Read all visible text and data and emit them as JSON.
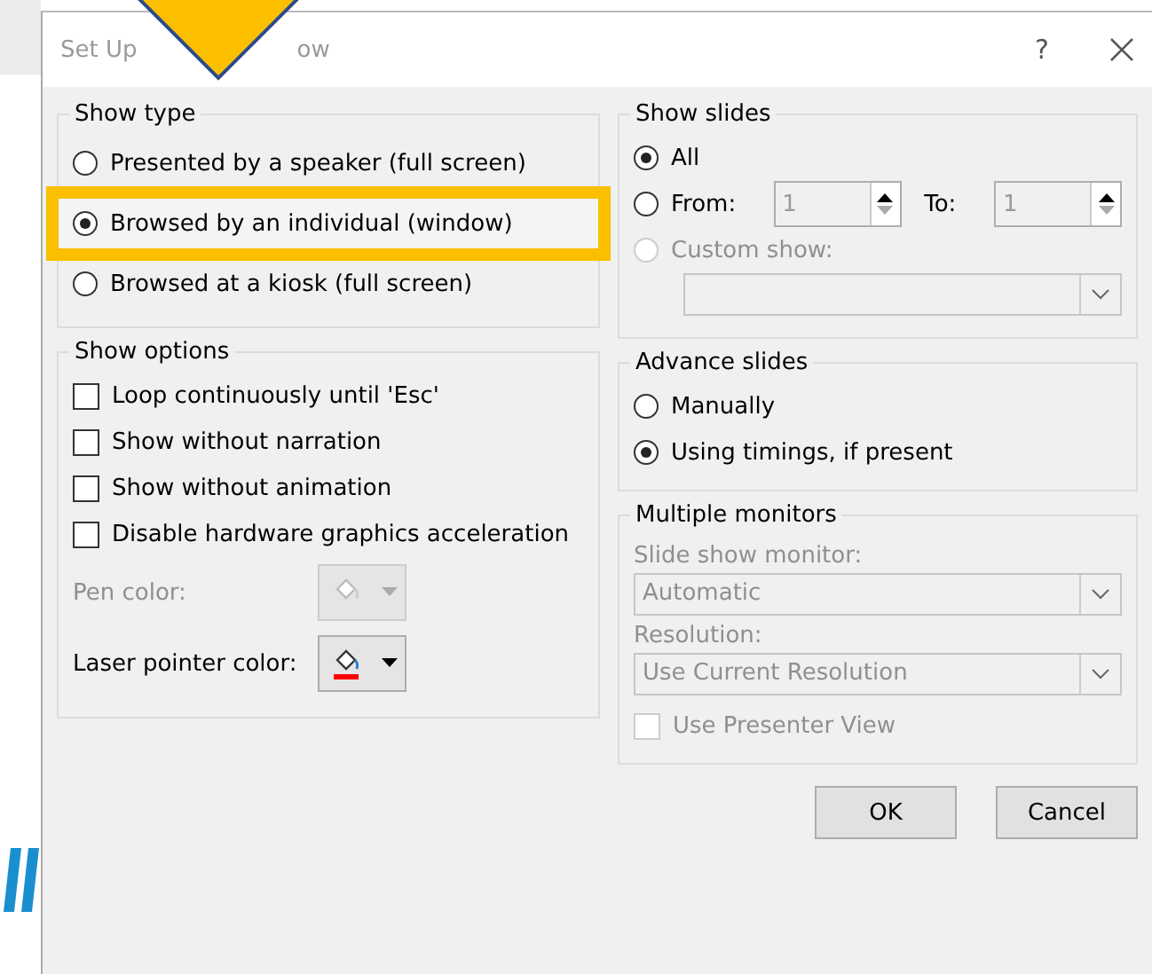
{
  "dialog": {
    "title_start": "Set Up",
    "title_end": "ow",
    "help": "?"
  },
  "show_type": {
    "label": "Show type",
    "options": [
      {
        "label": "Presented by a speaker (full screen)",
        "selected": false,
        "highlighted": false
      },
      {
        "label": "Browsed by an individual (window)",
        "selected": true,
        "highlighted": true
      },
      {
        "label": "Browsed at a kiosk (full screen)",
        "selected": false,
        "highlighted": false
      }
    ]
  },
  "show_options": {
    "label": "Show options",
    "checkboxes": [
      {
        "label": "Loop continuously until 'Esc'",
        "checked": false
      },
      {
        "label": "Show without narration",
        "checked": false
      },
      {
        "label": "Show without animation",
        "checked": false
      },
      {
        "label": "Disable hardware graphics acceleration",
        "checked": false
      }
    ],
    "colors": [
      {
        "label": "Pen color:",
        "disabled": true
      },
      {
        "label": "Laser pointer color:",
        "disabled": false,
        "color": "#ff0000"
      }
    ]
  },
  "show_slides": {
    "label": "Show slides",
    "options": [
      {
        "kind": "plain",
        "label": "All",
        "selected": true,
        "disabled": false
      },
      {
        "kind": "range",
        "label": "From:",
        "selected": false,
        "disabled": false,
        "from": "1",
        "to_label": "To:",
        "to": "1"
      },
      {
        "kind": "dropdown",
        "label": "Custom show:",
        "selected": false,
        "disabled": true
      }
    ]
  },
  "advance_slides": {
    "label": "Advance slides",
    "options": [
      {
        "label": "Manually",
        "selected": false
      },
      {
        "label": "Using timings, if present",
        "selected": true
      }
    ]
  },
  "multiple_monitors": {
    "label": "Multiple monitors",
    "disabled": true,
    "fields": [
      {
        "label": "Slide show monitor:",
        "value": "Automatic"
      },
      {
        "label": "Resolution:",
        "value": "Use Current Resolution"
      }
    ],
    "presenter_view": {
      "label": "Use Presenter View",
      "checked": false
    }
  },
  "buttons": [
    "OK",
    "Cancel"
  ]
}
